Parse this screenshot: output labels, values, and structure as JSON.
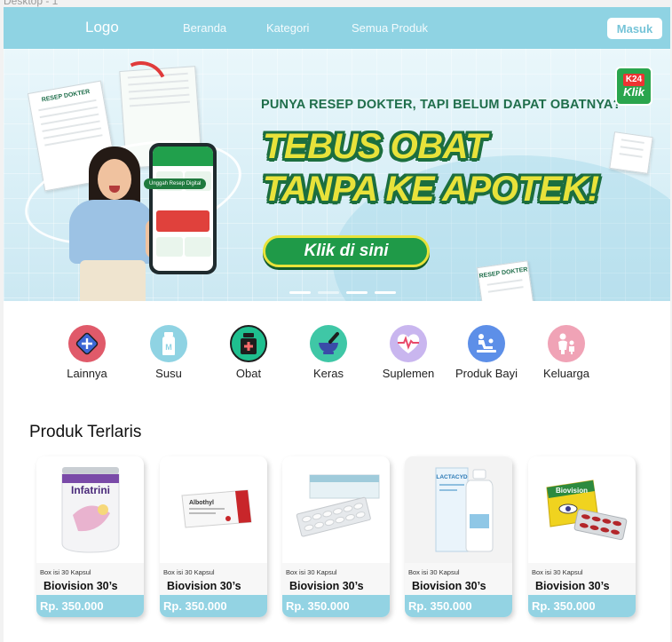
{
  "frame_label": "Desktop - 1",
  "nav": {
    "logo": "Logo",
    "links": [
      "Beranda",
      "Kategori",
      "Semua Produk"
    ],
    "login": "Masuk"
  },
  "banner": {
    "subheadline": "PUNYA RESEP DOKTER, TAPI BELUM DAPAT OBATNYA?",
    "headline_line1": "TEBUS OBAT",
    "headline_line2": "TANPA KE APOTEK!",
    "cta": "Klik di sini",
    "brand_top": "K24",
    "brand_bottom": "Klik",
    "prescription_title": "RESEP DOKTER",
    "phone_label": "Unggah Resep Digital",
    "slide_count": 4,
    "active_slide": 2
  },
  "categories": [
    {
      "label": "Lainnya",
      "icon": "plus-diamond-icon",
      "color": "#e05a6a"
    },
    {
      "label": "Susu",
      "icon": "milk-bottle-icon",
      "color": "#8fd3e3"
    },
    {
      "label": "Obat",
      "icon": "medicine-bottle-icon",
      "color": "#1fbf8f"
    },
    {
      "label": "Keras",
      "icon": "mortar-pestle-icon",
      "color": "#3fc7a6"
    },
    {
      "label": "Suplemen",
      "icon": "heart-pulse-icon",
      "color": "#c9b6ef"
    },
    {
      "label": "Produk Bayi",
      "icon": "baby-changing-icon",
      "color": "#5d8fe8"
    },
    {
      "label": "Keluarga",
      "icon": "family-icon",
      "color": "#f0a3b6"
    }
  ],
  "products_section": {
    "title": "Produk Terlaris",
    "items": [
      {
        "image": "infatrini-milk-can",
        "image_text": "Infatrini",
        "desc": "Box isi 30 Kapsul",
        "name": "Biovision 30’s",
        "price": "Rp. 350.000"
      },
      {
        "image": "albothyl-box",
        "image_text": "Albothyl",
        "desc": "Box isi 30 Kapsul",
        "name": "Biovision 30’s",
        "price": "Rp. 350.000"
      },
      {
        "image": "tablet-blister-pack",
        "image_text": "",
        "desc": "Box isi 30 Kapsul",
        "name": "Biovision 30’s",
        "price": "Rp. 350.000"
      },
      {
        "image": "lactacyd-bottle",
        "image_text": "LACTACYD",
        "desc": "Box isi 30 Kapsul",
        "name": "Biovision 30’s",
        "price": "Rp. 350.000"
      },
      {
        "image": "biovision-capsule-box",
        "image_text": "Biovision",
        "desc": "Box isi 30 Kapsul",
        "name": "Biovision 30’s",
        "price": "Rp. 350.000"
      }
    ]
  }
}
